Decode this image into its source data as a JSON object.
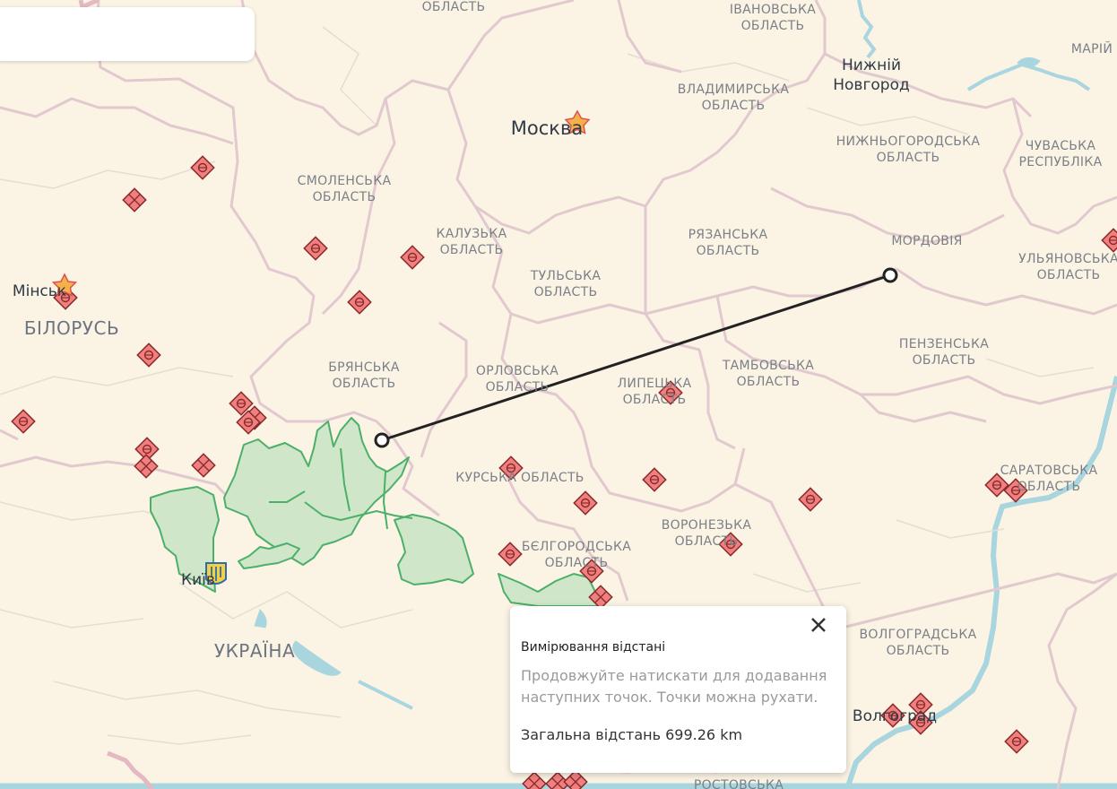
{
  "colors": {
    "land": "#fbf4e4",
    "border": "#e1c9cf",
    "subborder": "#e3ddd2",
    "water": "#a9d5df",
    "occupied_fill": "#cfe6c8",
    "occupied_stroke": "#4caf6a",
    "marker_fill": "#f08080",
    "marker_stroke": "#8a2a2a",
    "measure_line": "#222222"
  },
  "icons": {
    "capital": "star-icon",
    "marker": "airfield-diamond-icon",
    "close": "close-icon",
    "kyiv": "trident-coat-of-arms-icon"
  },
  "labels": {
    "oblast_top": "ОБЛАСТЬ",
    "ivanovska_1": "ІВАНОВСЬКА",
    "ivanovska_2": "ОБЛАСТЬ",
    "mariy": "МАРІЙ",
    "nizhny_1": "Нижній",
    "nizhny_2": "Новгород",
    "vladimirska_1": "ВЛАДИМИРСЬКА",
    "vladimirska_2": "ОБЛАСТЬ",
    "moskva": "Москва",
    "nizhegorodska_1": "НИЖНЬОГОРОДСЬКА",
    "nizhegorodska_2": "ОБЛАСТЬ",
    "chuvaska_1": "ЧУВАСЬКА",
    "chuvaska_2": "РЕСПУБЛІКА",
    "smolenska_1": "СМОЛЕНСЬКА",
    "smolenska_2": "ОБЛАСТЬ",
    "kaluzka_1": "КАЛУЗЬКА",
    "kaluzka_2": "ОБЛАСТЬ",
    "ryazanska_1": "РЯЗАНСЬКА",
    "ryazanska_2": "ОБЛАСТЬ",
    "mordovia": "МОРДОВІЯ",
    "ulyanovska_1": "УЛЬЯНОВСЬКА",
    "ulyanovska_2": "ОБЛАСТЬ",
    "tulska_1": "ТУЛЬСЬКА",
    "tulska_2": "ОБЛАСТЬ",
    "minsk": "Мінськ",
    "bilorus": "БІЛОРУСЬ",
    "penzenska_1": "ПЕНЗЕНСЬКА",
    "penzenska_2": "ОБЛАСТЬ",
    "bryanska_1": "БРЯНСЬКА",
    "bryanska_2": "ОБЛАСТЬ",
    "orlovska_1": "ОРЛОВСЬКА",
    "orlovska_2": "ОБЛАСТЬ",
    "lipetska_1": "ЛИПЕЦЬКА",
    "lipetska_2": "ОБЛАСТЬ",
    "tambovska_1": "ТАМБОВСЬКА",
    "tambovska_2": "ОБЛАСТЬ",
    "kurska": "КУРСЬКА ОБЛАСТЬ",
    "saratovska_1": "САРАТОВСЬКА",
    "saratovska_2": "ОБЛАСТЬ",
    "voronezka_1": "ВОРОНЕЗЬКА",
    "voronezka_2": "ОБЛАСТЬ",
    "belgorodska_1": "БЄЛГОРОДСЬКА",
    "belgorodska_2": "ОБЛАСТЬ",
    "kyiv": "Київ",
    "ukraina": "УКРАЇНА",
    "volgogradska_1": "ВОЛГОГРАДСЬКА",
    "volgogradska_2": "ОБЛАСТЬ",
    "volgograd": "Волгоград",
    "rostovska": "РОСТОВСЬКА"
  },
  "measure": {
    "title": "Вимірювання відстані",
    "hint": "Продовжуйте натискати для додавання наступних точок. Точки можна рухати.",
    "total_label": "Загальна відстань",
    "total_value": "699.26",
    "total_unit": "km"
  }
}
